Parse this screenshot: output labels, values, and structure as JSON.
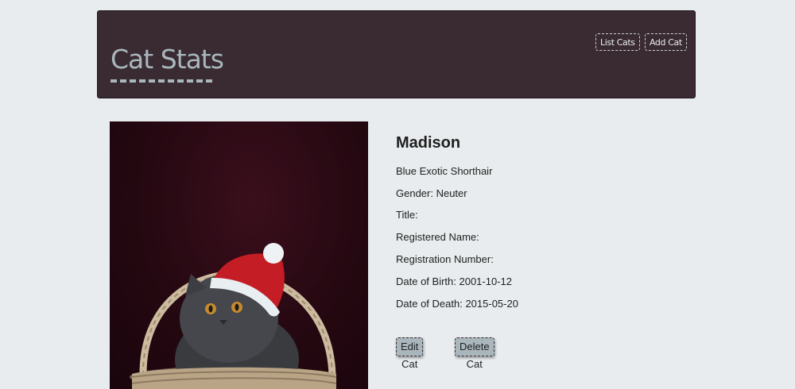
{
  "header": {
    "brand": "Cat Stats",
    "nav": {
      "list_label": "List Cats",
      "add_label": "Add Cat"
    }
  },
  "cat": {
    "name": "Madison",
    "breed": "Blue Exotic Shorthair",
    "gender": "Gender: Neuter",
    "title": "Title:",
    "registered_name": "Registered Name:",
    "registration_number": "Registration Number:",
    "date_of_birth": "Date of Birth: 2001-10-12",
    "date_of_death": "Date of Death: 2015-05-20"
  },
  "actions": {
    "edit_label": "Edit Cat",
    "delete_label": "Delete Cat"
  },
  "colors": {
    "header_bg": "#3a2b32",
    "brand": "#a9b7bd",
    "page_bg": "#e8ecee",
    "button_bg": "#a9b7bd"
  }
}
